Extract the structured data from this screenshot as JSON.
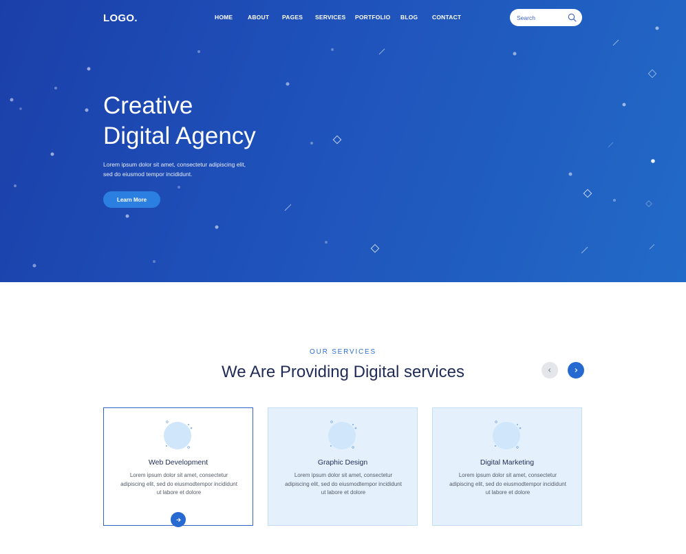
{
  "header": {
    "logo": "LOGO.",
    "nav": [
      "HOME",
      "ABOUT",
      "PAGES",
      "SERVICES",
      "PORTFOLIO",
      "BLOG",
      "CONTACT"
    ],
    "search_placeholder": "Search",
    "search_icon": "search-icon"
  },
  "hero": {
    "title_line1": "Creative",
    "title_line2": "Digital Agency",
    "desc_line1": "Lorem ipsum dolor sit amet, consectetur adipiscing elit,",
    "desc_line2": "sed do eiusmod tempor incididunt.",
    "button_label": "Learn More"
  },
  "services": {
    "eyebrow": "OUR SERVICES",
    "title": "We Are Providing Digital services",
    "prev_icon": "chevron-left-icon",
    "next_icon": "chevron-right-icon",
    "cards": [
      {
        "title": "Web Development",
        "text": "Lorem ipsum dolor sit amet, consectetur adipiscing elit, sed do eiusmodtempor incididunt ut labore et dolore",
        "active": true
      },
      {
        "title": "Graphic Design",
        "text": "Lorem ipsum dolor sit amet, consectetur adipiscing elit, sed do eiusmodtempor incididunt ut labore et dolore",
        "active": false
      },
      {
        "title": "Digital Marketing",
        "text": "Lorem ipsum dolor sit amet, consectetur adipiscing elit, sed do eiusmodtempor incididunt ut labore et dolore",
        "active": false
      }
    ],
    "card_button_icon": "arrow-right-icon"
  },
  "colors": {
    "hero_start": "#1b3fa9",
    "hero_end": "#226ac7",
    "accent": "#2569d1",
    "card_bg": "#e4f1fc",
    "heading": "#1f2a56"
  }
}
